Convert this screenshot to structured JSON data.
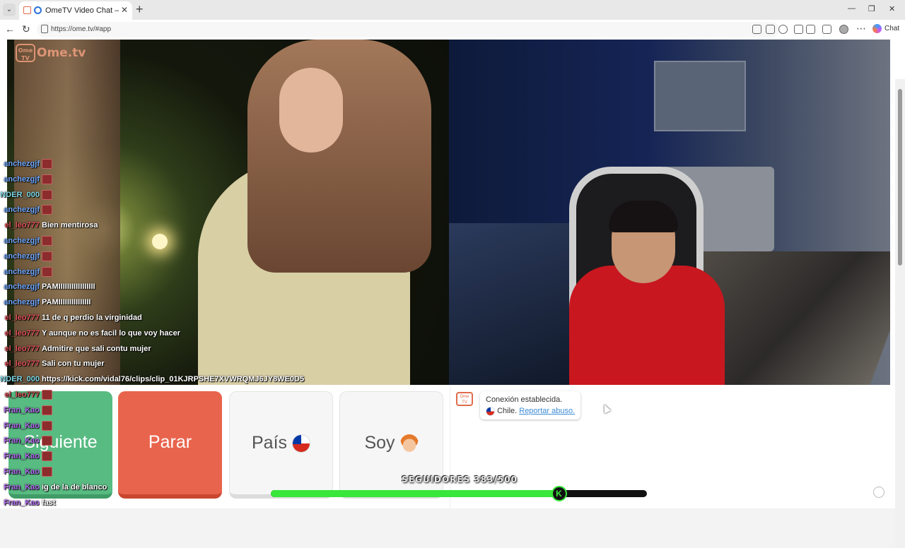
{
  "browser": {
    "tab_title": "OmeTV Video Chat — Omegle",
    "tab_close": "✕",
    "new_tab": "+",
    "url": "https://ome.tv/#app",
    "chat_label": "Chat",
    "win_min": "—",
    "win_max": "❐",
    "win_close": "✕"
  },
  "app": {
    "logo_text": "Ome.tv",
    "logo_badge": "Ome TV"
  },
  "stream_chat": [
    {
      "user": "anchezgjf",
      "user_color": "#6fa8ff",
      "text": ""
    },
    {
      "user": "anchezgjf",
      "user_color": "#6fa8ff",
      "text": ""
    },
    {
      "user": "NDER_000",
      "user_color": "#7fd8e6",
      "text": ""
    },
    {
      "user": "anchezgjf",
      "user_color": "#6fa8ff",
      "text": ""
    },
    {
      "user": "el_leo777",
      "user_color": "#e0525a",
      "text": "Bien mentirosa"
    },
    {
      "user": "anchezgjf",
      "user_color": "#6fa8ff",
      "text": ""
    },
    {
      "user": "anchezgjf",
      "user_color": "#6fa8ff",
      "text": ""
    },
    {
      "user": "anchezgjf",
      "user_color": "#6fa8ff",
      "text": ""
    },
    {
      "user": "anchezgjf",
      "user_color": "#6fa8ff",
      "text": "PAMIIIIIIIIIIIIIIIII"
    },
    {
      "user": "anchezgjf",
      "user_color": "#6fa8ff",
      "text": "PAMIIIIIIIIIIIIIII"
    },
    {
      "user": "el_leo777",
      "user_color": "#e0525a",
      "text": "11 de q perdio la virginidad"
    },
    {
      "user": "el_leo777",
      "user_color": "#e0525a",
      "text": "Y aunque no es facil lo que voy hacer"
    },
    {
      "user": "el_leo777",
      "user_color": "#e0525a",
      "text": "Admitire que sali contu mujer"
    },
    {
      "user": "el_leo777",
      "user_color": "#e0525a",
      "text": "Sali con tu mujer"
    },
    {
      "user": "NDER_000",
      "user_color": "#7fd8e6",
      "text": "https://kick.com/vidal76/clips/clip_01KJRPSHE7XVWRQMJ6JY8WE0D5"
    },
    {
      "user": "el_leo777",
      "user_color": "#e0525a",
      "text": ""
    },
    {
      "user": "Fran_Kao",
      "user_color": "#b06cf0",
      "text": ""
    },
    {
      "user": "Fran_Kao",
      "user_color": "#b06cf0",
      "text": ""
    },
    {
      "user": "Fran_Kao",
      "user_color": "#b06cf0",
      "text": ""
    },
    {
      "user": "Fran_Kao",
      "user_color": "#b06cf0",
      "text": ""
    },
    {
      "user": "Fran_Kao",
      "user_color": "#b06cf0",
      "text": ""
    },
    {
      "user": "Fran_Kao",
      "user_color": "#b06cf0",
      "text": "ig de la de blanco"
    },
    {
      "user": "Fran_Kao",
      "user_color": "#b06cf0",
      "text": "fast"
    }
  ],
  "controls": {
    "next_label": "Siguiente",
    "stop_label": "Parar",
    "country_label": "País",
    "gender_label": "Soy"
  },
  "chat_panel": {
    "icon_text": "Ome TV",
    "status": "Conexión establecida.",
    "country": "Chile.",
    "report_link": "Reportar abuso."
  },
  "followers": {
    "label": "SEGUIDORES 383/500",
    "current": 383,
    "goal": 500,
    "knob_text": "K"
  }
}
